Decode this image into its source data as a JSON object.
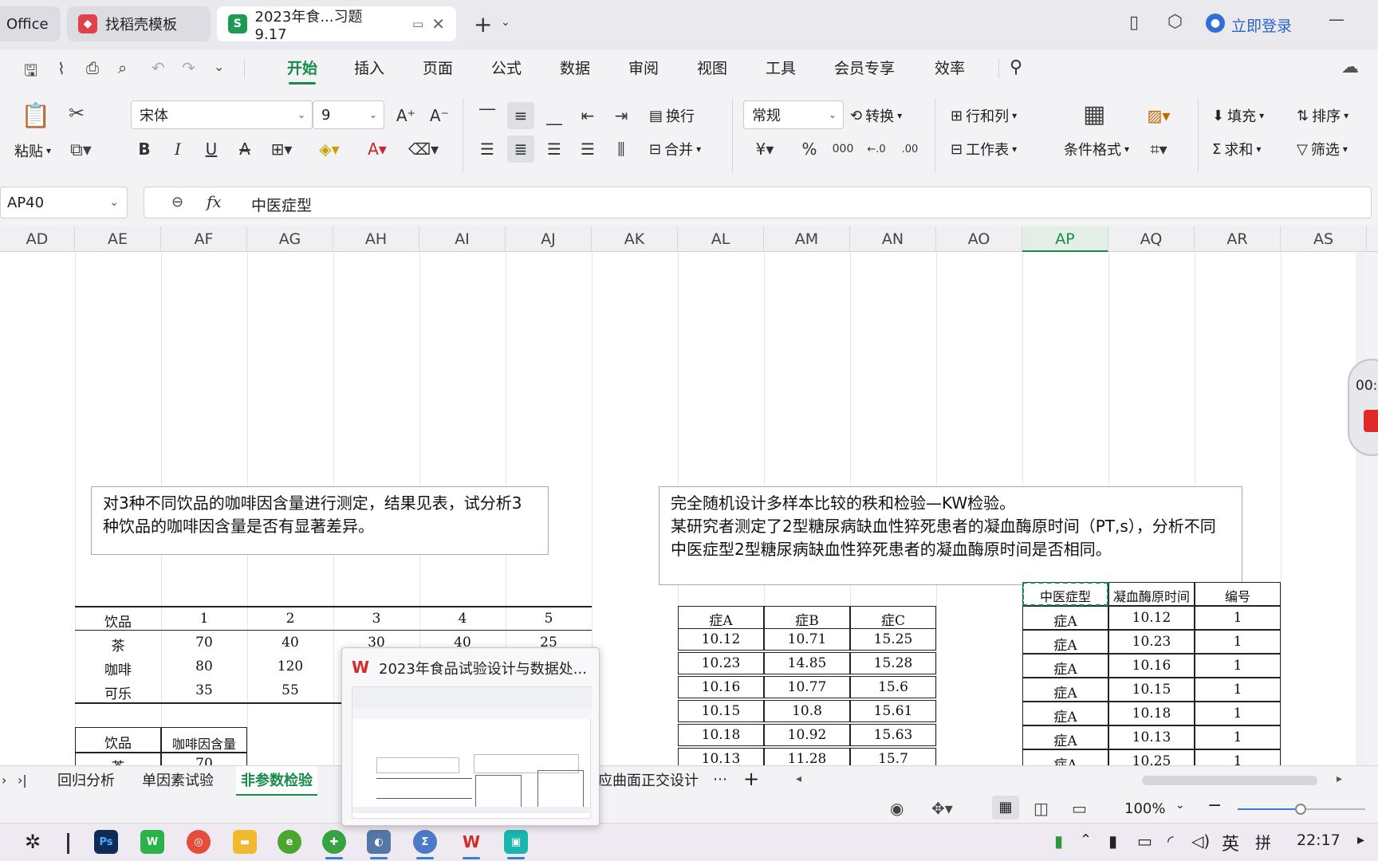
{
  "tabs": {
    "office": "Office",
    "template": "找稻壳模板",
    "doc": "2023年食...习题9.17",
    "login": "立即登录"
  },
  "menu": [
    "开始",
    "插入",
    "页面",
    "公式",
    "数据",
    "审阅",
    "视图",
    "工具",
    "会员专享",
    "效率"
  ],
  "ribbon": {
    "paste": "粘贴",
    "font": "宋体",
    "size": "9",
    "wrap": "换行",
    "merge": "合并",
    "format": "常规",
    "convert": "转换",
    "rowcol": "行和列",
    "sheet": "工作表",
    "condfmt": "条件格式",
    "fill": "填充",
    "sort": "排序",
    "sum": "求和",
    "filter": "筛选"
  },
  "namebox": "AP40",
  "formula": "中医症型",
  "columns": [
    "AD",
    "AE",
    "AF",
    "AG",
    "AH",
    "AI",
    "AJ",
    "AK",
    "AL",
    "AM",
    "AN",
    "AO",
    "AP",
    "AQ",
    "AR",
    "AS"
  ],
  "textbox1": "对3种不同饮品的咖啡因含量进行测定，结果见表，试分析3种饮品的咖啡因含量是否有显著差异。",
  "textbox2_line1": "完全随机设计多样本比较的秩和检验—KW检验。",
  "textbox2_line2": "某研究者测定了2型糖尿病缺血性猝死患者的凝血酶原时间（PT,s），分析不同中医症型2型糖尿病缺血性猝死患者的凝血酶原时间是否相同。",
  "table1": {
    "header": [
      "饮品",
      "1",
      "2",
      "3",
      "4",
      "5"
    ],
    "rows": [
      [
        "茶",
        "70",
        "40",
        "30",
        "40",
        "25"
      ],
      [
        "咖啡",
        "80",
        "120",
        "",
        "",
        ""
      ],
      [
        "可乐",
        "35",
        "55",
        "",
        "",
        ""
      ]
    ]
  },
  "table2": {
    "header": [
      "饮品",
      "咖啡因含量"
    ],
    "row1": [
      "茶",
      "70"
    ]
  },
  "table3": {
    "header": [
      "症A",
      "症B",
      "症C"
    ],
    "rows": [
      [
        "10.12",
        "10.71",
        "15.25"
      ],
      [
        "10.23",
        "14.85",
        "15.28"
      ],
      [
        "10.16",
        "10.77",
        "15.6"
      ],
      [
        "10.15",
        "10.8",
        "15.61"
      ],
      [
        "10.18",
        "10.92",
        "15.63"
      ],
      [
        "10.13",
        "11.28",
        "15.7"
      ]
    ]
  },
  "table4": {
    "header": [
      "中医症型",
      "凝血酶原时间",
      "编号"
    ],
    "rows": [
      [
        "症A",
        "10.12",
        "1"
      ],
      [
        "症A",
        "10.23",
        "1"
      ],
      [
        "症A",
        "10.16",
        "1"
      ],
      [
        "症A",
        "10.15",
        "1"
      ],
      [
        "症A",
        "10.18",
        "1"
      ],
      [
        "症A",
        "10.13",
        "1"
      ],
      [
        "症A",
        "10.25",
        "1"
      ]
    ]
  },
  "preview_title": "2023年食品试验设计与数据处...",
  "sheets": [
    "回归分析",
    "单因素试验",
    "非参数检验",
    "应曲面正交设计"
  ],
  "zoom": "100%",
  "clock": "22:17",
  "ime1": "英",
  "ime2": "拼",
  "rec_time": "00:"
}
